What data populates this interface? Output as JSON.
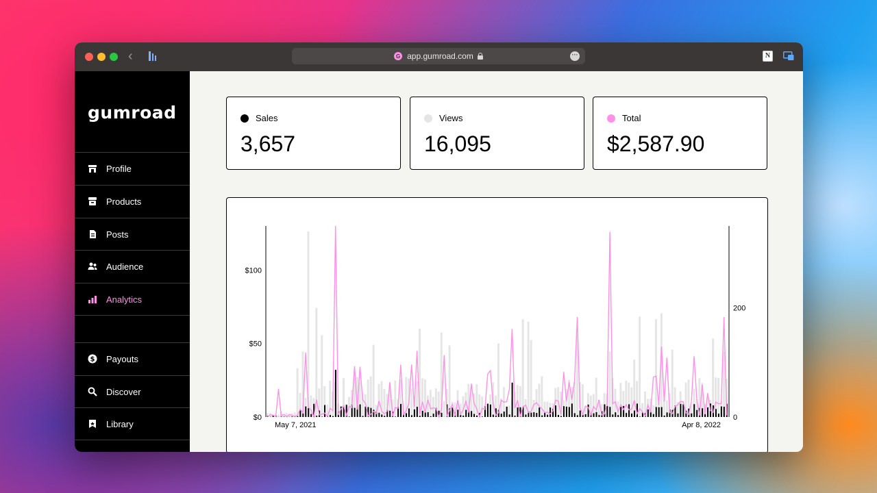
{
  "browser": {
    "url": "app.gumroad.com",
    "favicon_letter": "G",
    "back_icon": "chevron-left-icon",
    "more_icon": "ellipsis-icon"
  },
  "sidebar": {
    "logo": "Gumroad",
    "items": [
      {
        "label": "Profile",
        "icon": "store-icon",
        "active": false
      },
      {
        "label": "Products",
        "icon": "archive-box-icon",
        "active": false
      },
      {
        "label": "Posts",
        "icon": "document-icon",
        "active": false
      },
      {
        "label": "Audience",
        "icon": "people-icon",
        "active": false
      },
      {
        "label": "Analytics",
        "icon": "bar-chart-icon",
        "active": true
      }
    ],
    "bottom_items": [
      {
        "label": "Payouts",
        "icon": "dollar-circle-icon"
      },
      {
        "label": "Discover",
        "icon": "search-icon"
      },
      {
        "label": "Library",
        "icon": "bookmark-icon"
      }
    ]
  },
  "stats": [
    {
      "label": "Sales",
      "value": "3,657",
      "color": "#000000"
    },
    {
      "label": "Views",
      "value": "16,095",
      "color": "#e5e5e5"
    },
    {
      "label": "Total",
      "value": "$2,587.90",
      "color": "#ff90e8"
    }
  ],
  "colors": {
    "accent": "#ff90e8",
    "views": "#e5e5e5",
    "sales": "#000000",
    "sidebar_bg": "#000000",
    "main_bg": "#f4f4f0"
  },
  "chart_data": {
    "type": "bar",
    "x_start": "May 7, 2021",
    "x_end": "Apr 8, 2022",
    "left_axis_ticks": [
      "$0",
      "$50",
      "$100"
    ],
    "left_axis_values": [
      0,
      50,
      100
    ],
    "left_axis_range": [
      0,
      130
    ],
    "right_axis_ticks": [
      "0",
      "200"
    ],
    "right_axis_values": [
      0,
      200
    ],
    "right_axis_range": [
      0,
      350
    ],
    "series": [
      {
        "name": "Views",
        "kind": "bar",
        "axis": "right",
        "color": "#e5e5e5"
      },
      {
        "name": "Sales",
        "kind": "bar",
        "axis": "right",
        "color": "#000000"
      },
      {
        "name": "Total",
        "kind": "line",
        "axis": "left",
        "color": "#ff90e8"
      }
    ],
    "peaks": {
      "total_max": 130,
      "total_second": 126,
      "views_max": 340
    }
  }
}
